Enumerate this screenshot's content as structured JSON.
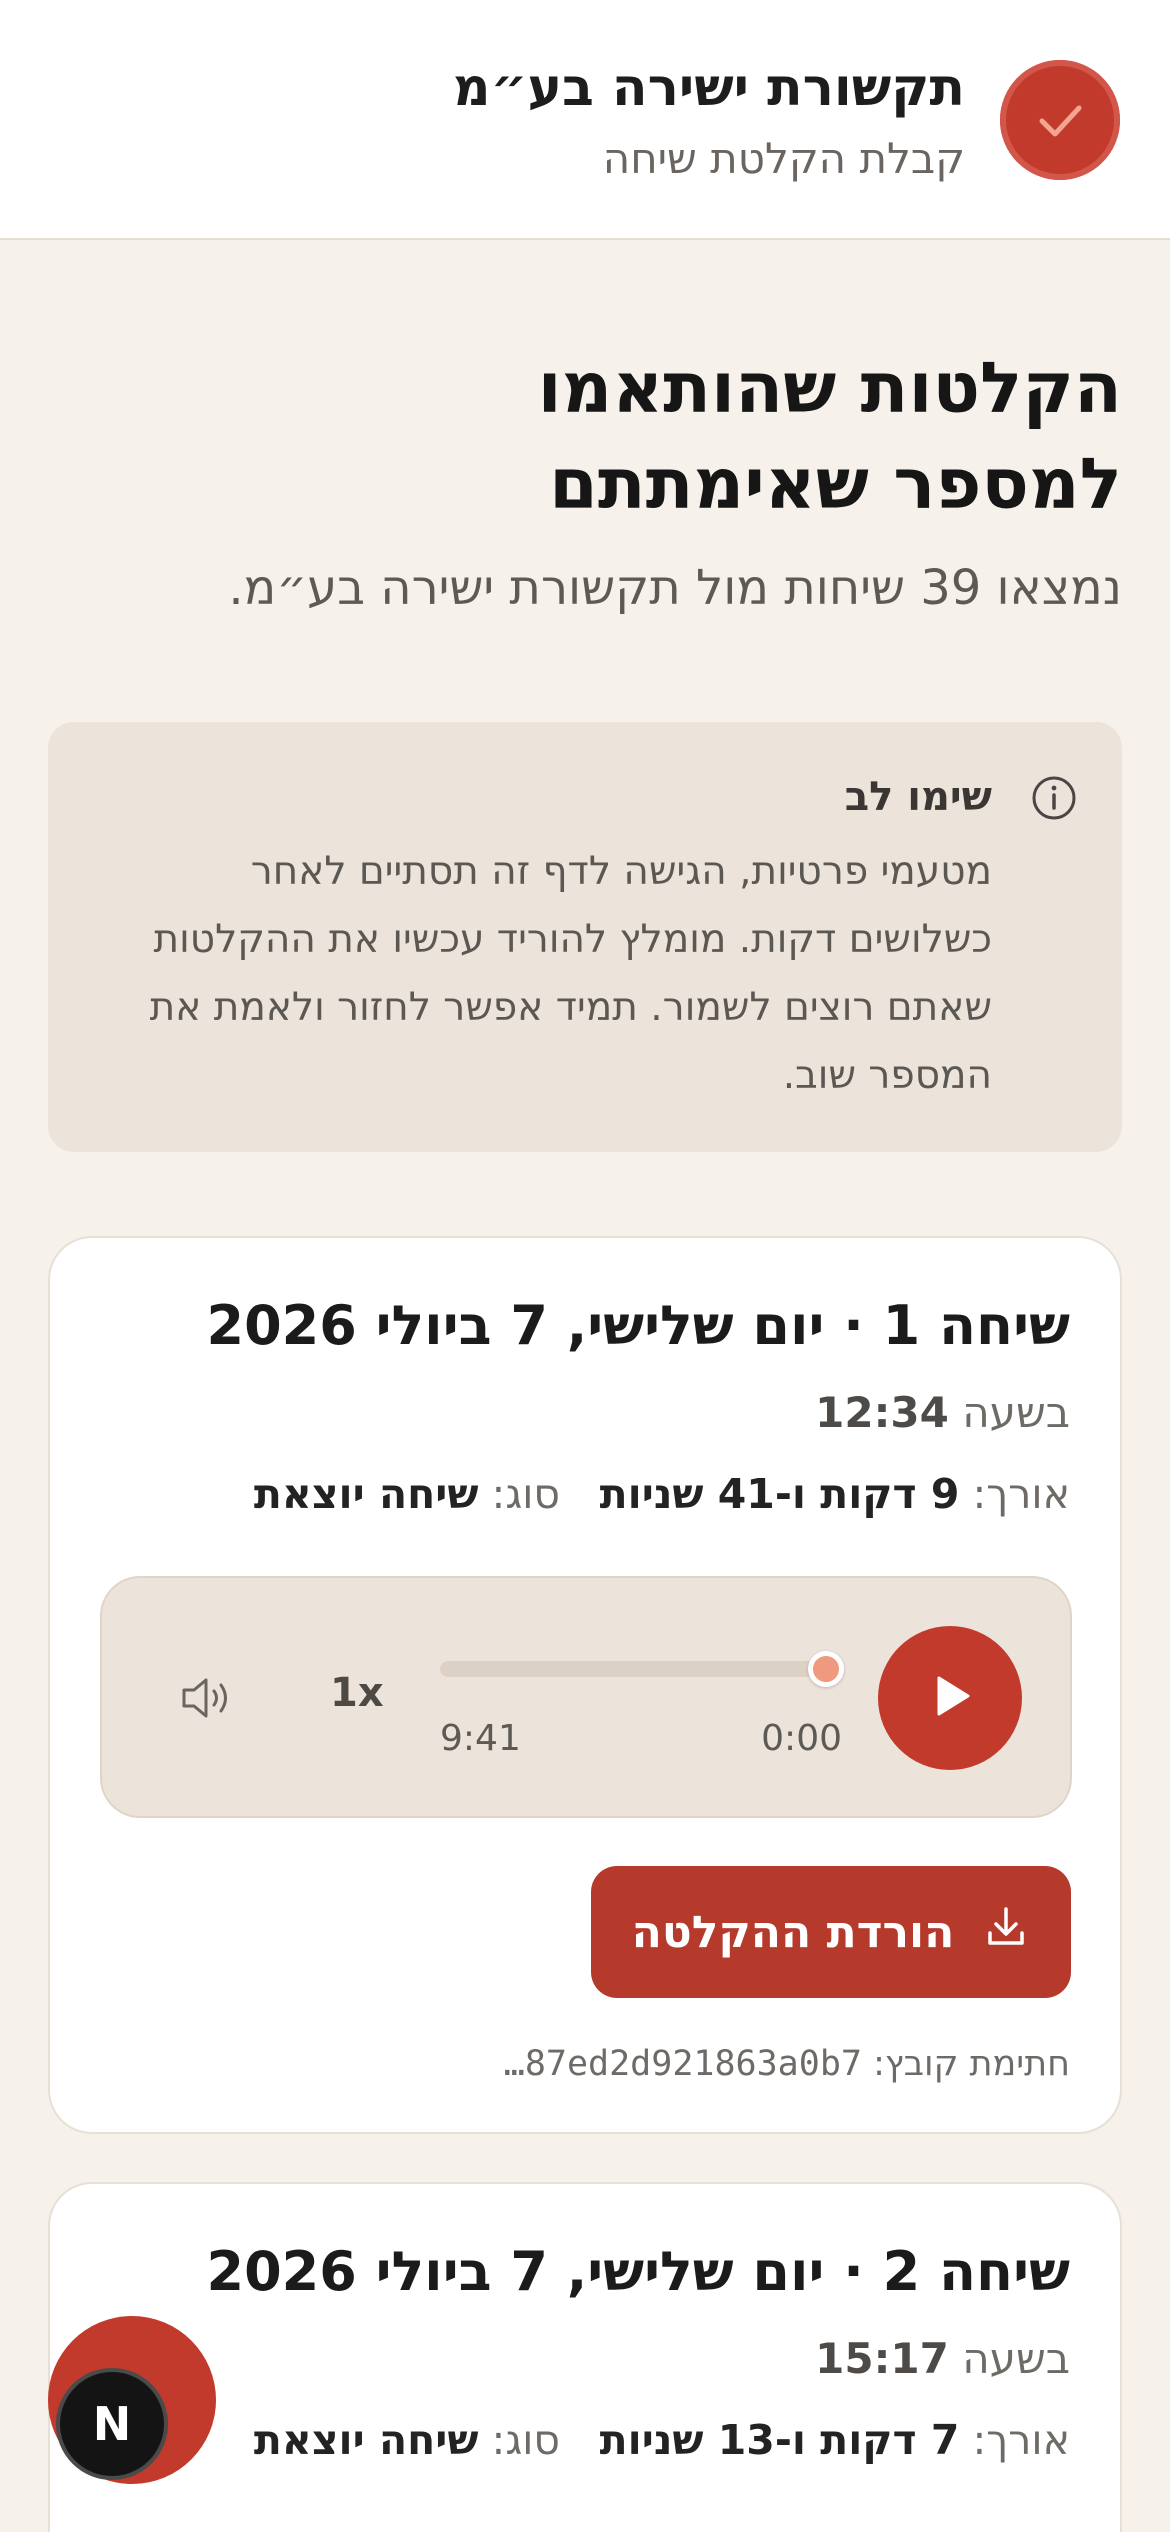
{
  "header": {
    "company_name": "תקשורת ישירה בע״מ",
    "subtitle": "קבלת הקלטת שיחה",
    "logo_icon": "check-icon",
    "logo_color": "#c23a2c"
  },
  "hero": {
    "title_line1": "הקלטות שהותאמו",
    "title_line2": "למספר שאימתתם",
    "summary": "נמצאו 39 שיחות מול תקשורת ישירה בע״מ."
  },
  "notice": {
    "title": "שימו לב",
    "body": "מטעמי פרטיות, הגישה לדף זה תסתיים לאחר כשלושים דקות. מומלץ להוריד עכשיו את ההקלטות שאתם רוצים לשמור. תמיד אפשר לחזור ולאמת את המספר שוב.",
    "icon": "info-icon"
  },
  "calls": [
    {
      "title": "שיחה 1 · יום שלישי, 7 ביולי 2026",
      "time_prefix": "בשעה",
      "time": "12:34",
      "length_label": "אורך:",
      "length_value": "9 דקות ו-41 שניות",
      "type_label": "סוג:",
      "type_value": "שיחה יוצאת",
      "player": {
        "current_time": "0:00",
        "total_time": "9:41",
        "speed": "1x",
        "progress": 0
      },
      "download_label": "הורדת ההקלטה",
      "file_sig_label": "חתימת קובץ:",
      "file_sig_value": "…87ed2d921863a0b7"
    },
    {
      "title": "שיחה 2 · יום שלישי, 7 ביולי 2026",
      "time_prefix": "בשעה",
      "time": "15:17",
      "length_label": "אורך:",
      "length_value": "7 דקות ו-13 שניות",
      "type_label": "סוג:",
      "type_value": "שיחה יוצאת"
    }
  ],
  "fab": {
    "label": "N"
  },
  "colors": {
    "accent": "#c23a2c",
    "background": "#f6f1ea",
    "panel": "#ece3da",
    "progress_knob": "#ef9a7e"
  }
}
